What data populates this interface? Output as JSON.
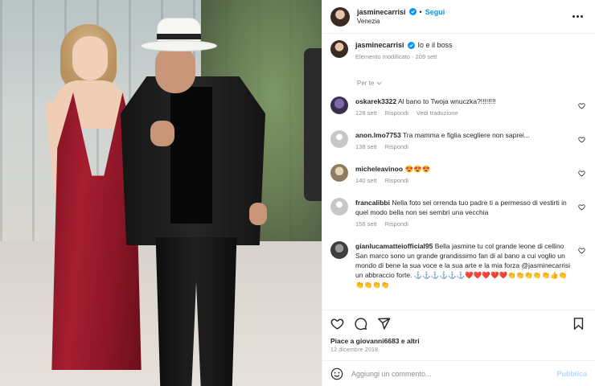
{
  "post": {
    "username": "jasminecarrisi",
    "follow_label": "Segui",
    "separator": "•",
    "location": "Venezia",
    "icons": {
      "more": "more-options-icon",
      "verified": "verified-badge-icon",
      "like": "heart-icon",
      "comment": "comment-icon",
      "share": "share-icon",
      "save": "bookmark-icon",
      "emoji": "emoji-icon"
    },
    "colors": {
      "link": "#0095f6",
      "muted": "#8e8e8e",
      "dress": "#a51e30"
    }
  },
  "caption": {
    "username": "jasminecarrisi",
    "text": "Io e il boss",
    "edited": "Elemento modificato · 209 sett"
  },
  "for_you_label": "Per te",
  "comments": [
    {
      "username": "oskarek3322",
      "text": "Al bano to Twoja wnuczka?!!!!!!!!",
      "time": "128 sett",
      "reply": "Rispondi",
      "extra": "Vedi traduzione",
      "avatar_color": "#3a2f4f"
    },
    {
      "username": "anon.lmo7753",
      "text": "Tra mamma e figlia scegliere non saprei...",
      "time": "138 sett",
      "reply": "Rispondi",
      "avatar_color": "#dbdbdb"
    },
    {
      "username": "micheleavinoo",
      "text": "😍😍😍",
      "time": "140 sett",
      "reply": "Rispondi",
      "avatar_color": "#b8a98c"
    },
    {
      "username": "francalibbi",
      "text": "Nella foto sei orrenda tuo padre ti a permesso di vestirti in quel modo bella non sei sembri una vecchia",
      "time": "158 sett",
      "reply": "Rispondi",
      "avatar_color": "#dbdbdb"
    },
    {
      "username": "gianlucamatteiofficial95",
      "text": "Bella jasmine tu col grande leone di cellino San marco sono un grande grandissimo fan di al bano a cui voglio un mondo di bene la sua voce e la sua arte e la mia forza @jasminecarrisi un abbraccio forte. ⚓⚓⚓⚓⚓⚓❤️❤️❤️❤️❤️👏👏👏👏👏👍👏👏👏👏👏",
      "avatar_color": "#4d4d4d"
    }
  ],
  "footer": {
    "likes_text": "Piace a giovanni6683 e altri",
    "likes_user": "giovanni6683",
    "date": "12 dicembre 2018",
    "comment_placeholder": "Aggiungi un commento...",
    "publish_label": "Pubblica"
  }
}
